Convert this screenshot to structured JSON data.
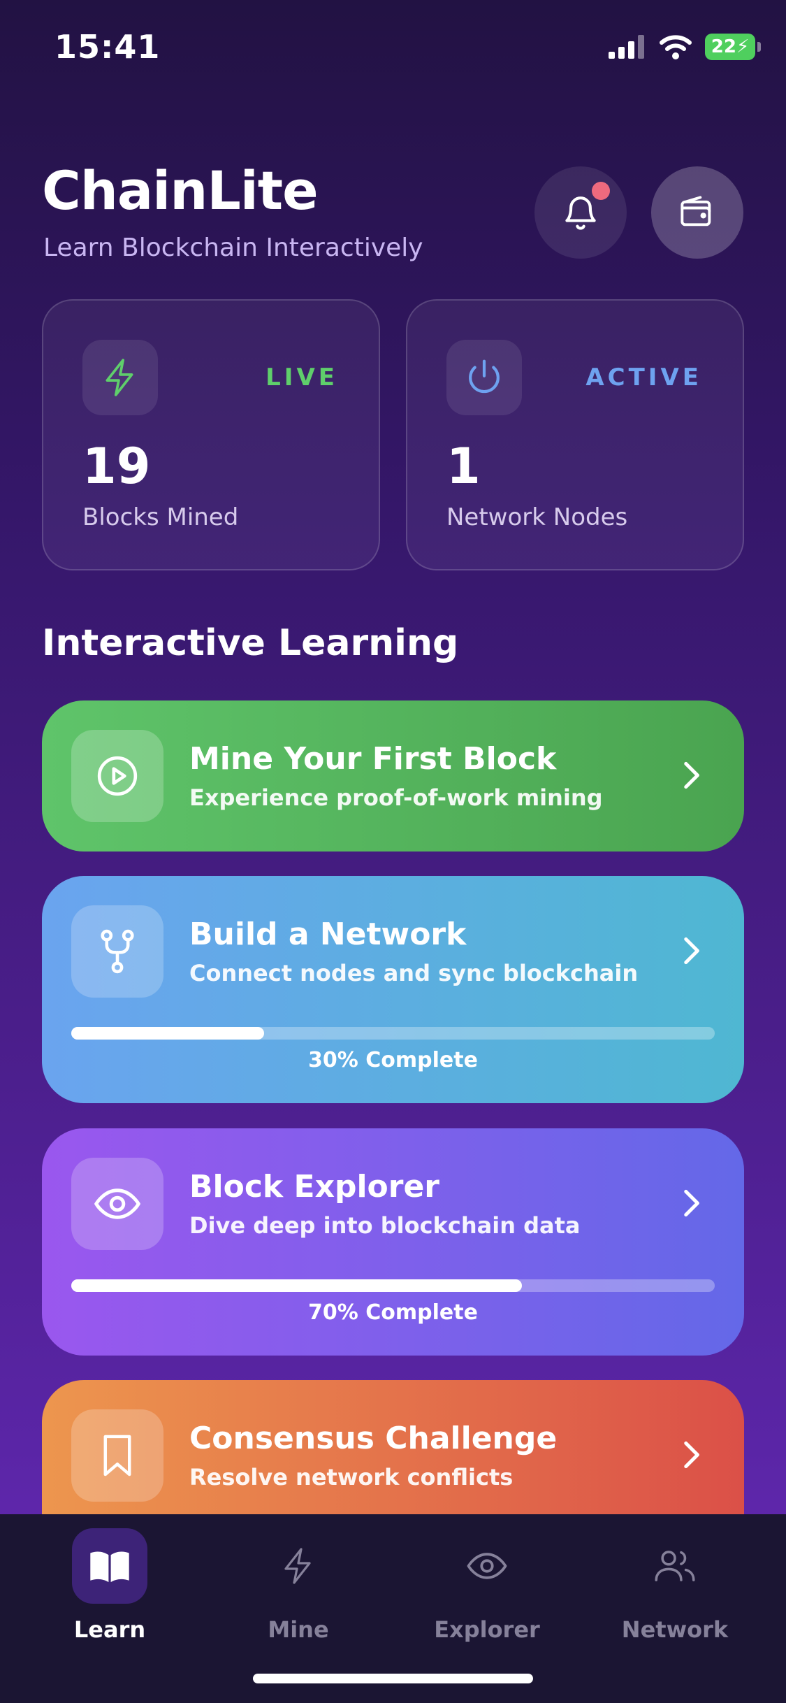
{
  "status_bar": {
    "time": "15:41",
    "battery": "22"
  },
  "header": {
    "title": "ChainLite",
    "subtitle": "Learn Blockchain Interactively",
    "notification_dot": true
  },
  "stats": [
    {
      "badge": "LIVE",
      "badge_color": "#5fcf6b",
      "value": "19",
      "label": "Blocks Mined",
      "icon": "lightning-icon"
    },
    {
      "badge": "ACTIVE",
      "badge_color": "#6ea2f0",
      "value": "1",
      "label": "Network Nodes",
      "icon": "power-icon"
    }
  ],
  "section": {
    "title": "Interactive Learning"
  },
  "lessons": [
    {
      "title": "Mine Your First Block",
      "description": "Experience proof-of-work mining",
      "icon": "play-icon"
    },
    {
      "title": "Build a Network",
      "description": "Connect nodes and sync blockchain",
      "icon": "branch-icon",
      "progress": 30,
      "progress_text": "30% Complete"
    },
    {
      "title": "Block Explorer",
      "description": "Dive deep into blockchain data",
      "icon": "eye-icon",
      "progress": 70,
      "progress_text": "70% Complete"
    },
    {
      "title": "Consensus Challenge",
      "description": "Resolve network conflicts",
      "icon": "bookmark-icon"
    }
  ],
  "tabs": [
    {
      "label": "Learn",
      "icon": "book-icon",
      "active": true
    },
    {
      "label": "Mine",
      "icon": "lightning-icon",
      "active": false
    },
    {
      "label": "Explorer",
      "icon": "eye-icon",
      "active": false
    },
    {
      "label": "Network",
      "icon": "users-icon",
      "active": false
    }
  ]
}
